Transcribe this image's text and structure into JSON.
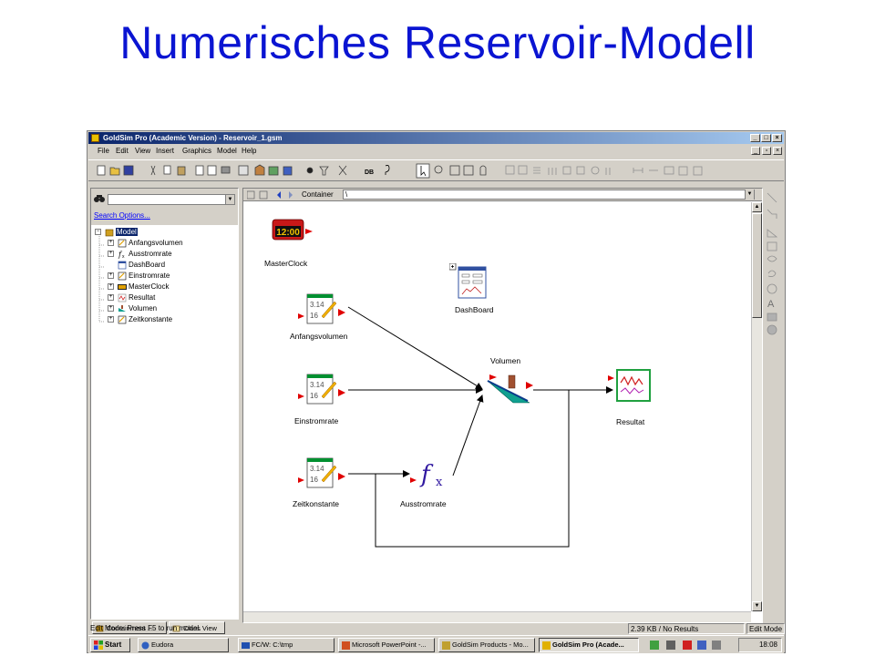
{
  "slide": {
    "title": "Numerisches Reservoir-Modell"
  },
  "window": {
    "title": "GoldSim Pro (Academic Version) - Reservoir_1.gsm"
  },
  "menu": [
    "File",
    "Edit",
    "View",
    "Insert",
    "Graphics",
    "Model",
    "Help"
  ],
  "browser": {
    "search_link": "Search Options...",
    "root": "Model",
    "items": [
      "Anfangsvolumen",
      "Ausstromrate",
      "DashBoard",
      "Einstromrate",
      "MasterClock",
      "Resultat",
      "Volumen",
      "Zeitkonstante"
    ],
    "tabs": [
      "Containment ...",
      "Class View"
    ]
  },
  "graph": {
    "container_label": "Container",
    "path": "\\",
    "elements": {
      "masterclock": {
        "label": "MasterClock",
        "display": "12:00"
      },
      "dashboard": {
        "label": "DashBoard"
      },
      "anfangsvolumen": {
        "label": "Anfangsvolumen",
        "value": "3.14",
        "value2": "16"
      },
      "einstromrate": {
        "label": "Einstromrate",
        "value": "3.14",
        "value2": "16"
      },
      "zeitkonstante": {
        "label": "Zeitkonstante",
        "value": "3.14",
        "value2": "16"
      },
      "volumen": {
        "label": "Volumen"
      },
      "ausstromrate": {
        "label": "Ausstromrate",
        "symbol": "f",
        "sub": "x"
      },
      "resultat": {
        "label": "Resultat"
      }
    }
  },
  "status": {
    "mode_text": "Edit Mode: Press F5 to run model.",
    "size_text": "2.39 KB / No Results",
    "mode": "Edit Mode"
  },
  "taskbar": {
    "start": "Start",
    "tasks": [
      "Eudora",
      "FC/W: C:\\tmp",
      "Microsoft PowerPoint -...",
      "GoldSim Products - Mo...",
      "GoldSim Pro (Acade..."
    ],
    "clock": "18:08"
  },
  "colors": {
    "title_blue": "#0a14d2",
    "titlebar": "#0a246a",
    "chrome": "#d4d0c8",
    "arrow_red": "#e00000",
    "data_green": "#009030",
    "volumen_teal": "#10a090"
  }
}
